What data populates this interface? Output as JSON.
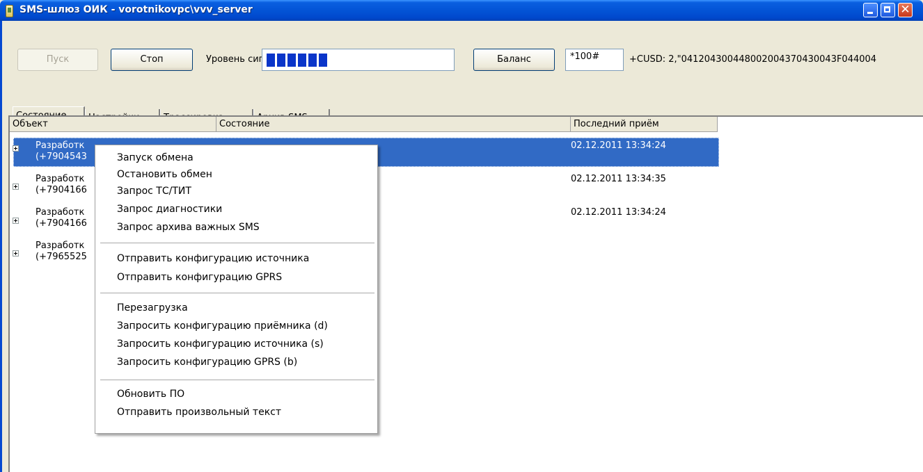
{
  "window": {
    "title": "SMS-шлюз ОИК - vorotnikovpc\\vvv_server"
  },
  "toolbar": {
    "start_label": "Пуск",
    "stop_label": "Стоп",
    "signal_label": "Уровень сигнала:",
    "signal_level": 0.42,
    "balance_label": "Баланс",
    "ussd_value": "*100#",
    "response": "+CUSD: 2,\"041204300448002004370430043F044004"
  },
  "tabs": [
    {
      "label": "Состояние",
      "active": true
    },
    {
      "label": "Настройки"
    },
    {
      "label": "Трассировка"
    },
    {
      "label": "Архив SMS"
    }
  ],
  "table": {
    "columns": [
      "Объект",
      "Состояние",
      "Последний приём"
    ],
    "rows": [
      {
        "object_line1": "Разработк",
        "object_line2": "(+7904543",
        "last": "02.12.2011 13:34:24",
        "selected": true
      },
      {
        "object_line1": "Разработк",
        "object_line2": "(+7904166",
        "last": "02.12.2011 13:34:35"
      },
      {
        "object_line1": "Разработк",
        "object_line2": "(+7904166",
        "last": "02.12.2011 13:34:24"
      },
      {
        "object_line1": "Разработк",
        "object_line2": "(+7965525",
        "last": ""
      }
    ]
  },
  "context_menu": {
    "groups": [
      [
        "Запуск обмена",
        "Остановить обмен",
        "Запрос ТС/ТИТ",
        "Запрос диагностики",
        "Запрос архива важных SMS"
      ],
      [
        "Отправить конфигурацию источника",
        "Отправить конфигурацию GPRS"
      ],
      [
        "Перезагрузка",
        "Запросить конфигурацию приёмника (d)",
        "Запросить конфигурацию источника (s)",
        "Запросить конфигурацию GPRS (b)"
      ],
      [
        "Обновить ПО",
        "Отправить произвольный текст"
      ]
    ]
  },
  "colors": {
    "titlebar": "#0354d6",
    "selection": "#316ac5",
    "signal": "#0a35c9"
  }
}
